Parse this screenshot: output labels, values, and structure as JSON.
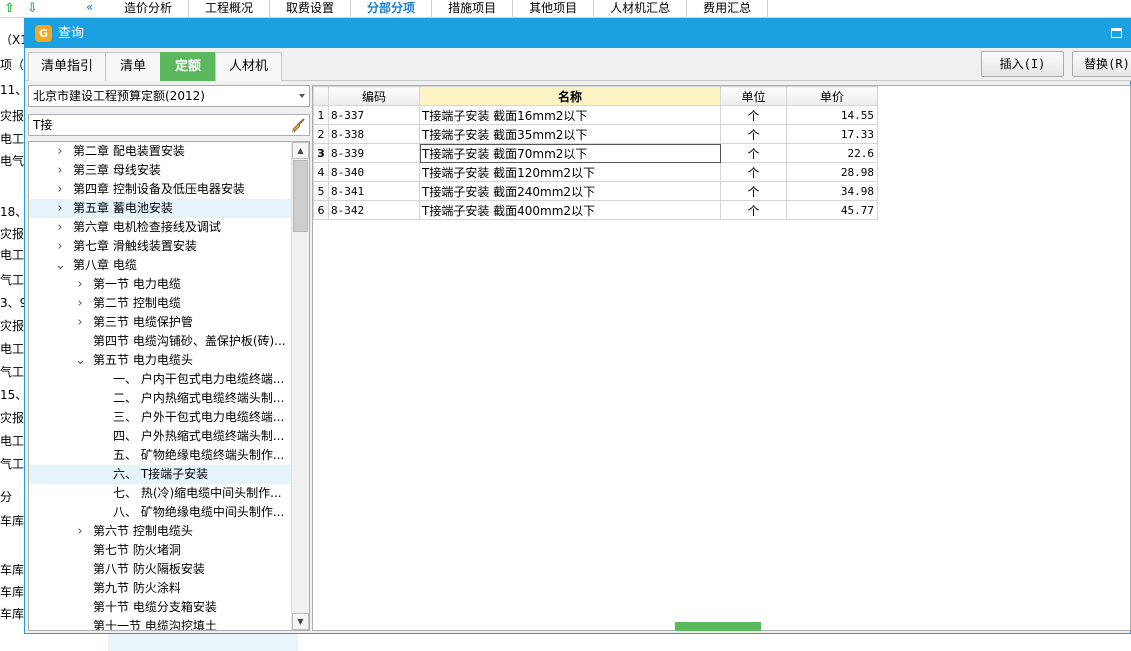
{
  "background": {
    "menu": [
      {
        "label": "造价分析",
        "active": false
      },
      {
        "label": "工程概况",
        "active": false
      },
      {
        "label": "取费设置",
        "active": false
      },
      {
        "label": "分部分项",
        "active": true
      },
      {
        "label": "措施项目",
        "active": false
      },
      {
        "label": "其他项目",
        "active": false
      },
      {
        "label": "人材机汇总",
        "active": false
      },
      {
        "label": "费用汇总",
        "active": false
      }
    ],
    "left_fragments": [
      "（X1",
      "项（",
      "11、",
      "灾报",
      "电工",
      "电气",
      "18、",
      "灾报",
      "电工",
      "气工",
      "3、9",
      "灾报",
      "电工",
      "气工",
      "15、",
      "灾报",
      "电工",
      "气工",
      "分",
      "车库",
      "车库",
      "车库",
      "车库"
    ]
  },
  "dialog": {
    "title": "查询",
    "tabs": [
      "清单指引",
      "清单",
      "定额",
      "人材机"
    ],
    "active_tab": 2,
    "insert_button": "插入(I)",
    "replace_button": "替换(R)"
  },
  "left_panel": {
    "library": "北京市建设工程预算定额(2012)",
    "search_value": "T接",
    "tree": [
      {
        "label": "第二章 配电装置安装",
        "level": 0,
        "expander": ">",
        "hl": false
      },
      {
        "label": "第三章 母线安装",
        "level": 0,
        "expander": ">",
        "hl": false
      },
      {
        "label": "第四章 控制设备及低压电器安装",
        "level": 0,
        "expander": ">",
        "hl": false
      },
      {
        "label": "第五章 蓄电池安装",
        "level": 0,
        "expander": ">",
        "hl": true
      },
      {
        "label": "第六章 电机检查接线及调试",
        "level": 0,
        "expander": ">",
        "hl": false
      },
      {
        "label": "第七章 滑触线装置安装",
        "level": 0,
        "expander": ">",
        "hl": false
      },
      {
        "label": "第八章 电缆",
        "level": 0,
        "expander": "v",
        "hl": false
      },
      {
        "label": "第一节 电力电缆",
        "level": 1,
        "expander": ">",
        "hl": false
      },
      {
        "label": "第二节 控制电缆",
        "level": 1,
        "expander": ">",
        "hl": false
      },
      {
        "label": "第三节 电缆保护管",
        "level": 1,
        "expander": ">",
        "hl": false
      },
      {
        "label": "第四节 电缆沟铺砂、盖保护板(砖)...",
        "level": 1,
        "expander": "",
        "hl": false
      },
      {
        "label": "第五节 电力电缆头",
        "level": 1,
        "expander": "v",
        "hl": false
      },
      {
        "label": "一、 户内干包式电力电缆终端...",
        "level": 2,
        "expander": "",
        "hl": false
      },
      {
        "label": "二、 户内热缩式电缆终端头制...",
        "level": 2,
        "expander": "",
        "hl": false
      },
      {
        "label": "三、 户外干包式电力电缆终端...",
        "level": 2,
        "expander": "",
        "hl": false
      },
      {
        "label": "四、 户外热缩式电缆终端头制...",
        "level": 2,
        "expander": "",
        "hl": false
      },
      {
        "label": "五、 矿物绝缘电缆终端头制作...",
        "level": 2,
        "expander": "",
        "hl": false
      },
      {
        "label": "六、 T接端子安装",
        "level": 2,
        "expander": "",
        "hl": true
      },
      {
        "label": "七、 热(冷)缩电缆中间头制作...",
        "level": 2,
        "expander": "",
        "hl": false
      },
      {
        "label": "八、 矿物绝缘电缆中间头制作...",
        "level": 2,
        "expander": "",
        "hl": false
      },
      {
        "label": "第六节 控制电缆头",
        "level": 1,
        "expander": ">",
        "hl": false
      },
      {
        "label": "第七节 防火堵洞",
        "level": 1,
        "expander": "",
        "hl": false
      },
      {
        "label": "第八节 防火隔板安装",
        "level": 1,
        "expander": "",
        "hl": false
      },
      {
        "label": "第九节 防火涂料",
        "level": 1,
        "expander": "",
        "hl": false
      },
      {
        "label": "第十节 电缆分支箱安装",
        "level": 1,
        "expander": "",
        "hl": false
      },
      {
        "label": "第十一节 电缆沟挖填土",
        "level": 1,
        "expander": "",
        "hl": false
      }
    ]
  },
  "grid": {
    "columns": [
      "编码",
      "名称",
      "单位",
      "单价"
    ],
    "rows": [
      {
        "no": "1",
        "code": "8-337",
        "name": "T接端子安装 截面16mm2以下",
        "unit": "个",
        "price": "14.55"
      },
      {
        "no": "2",
        "code": "8-338",
        "name": "T接端子安装 截面35mm2以下",
        "unit": "个",
        "price": "17.33"
      },
      {
        "no": "3",
        "code": "8-339",
        "name": "T接端子安装 截面70mm2以下",
        "unit": "个",
        "price": "22.6"
      },
      {
        "no": "4",
        "code": "8-340",
        "name": "T接端子安装 截面120mm2以下",
        "unit": "个",
        "price": "28.98"
      },
      {
        "no": "5",
        "code": "8-341",
        "name": "T接端子安装 截面240mm2以下",
        "unit": "个",
        "price": "34.98"
      },
      {
        "no": "6",
        "code": "8-342",
        "name": "T接端子安装 截面400mm2以下",
        "unit": "个",
        "price": "45.77"
      }
    ],
    "current_row": 2
  }
}
